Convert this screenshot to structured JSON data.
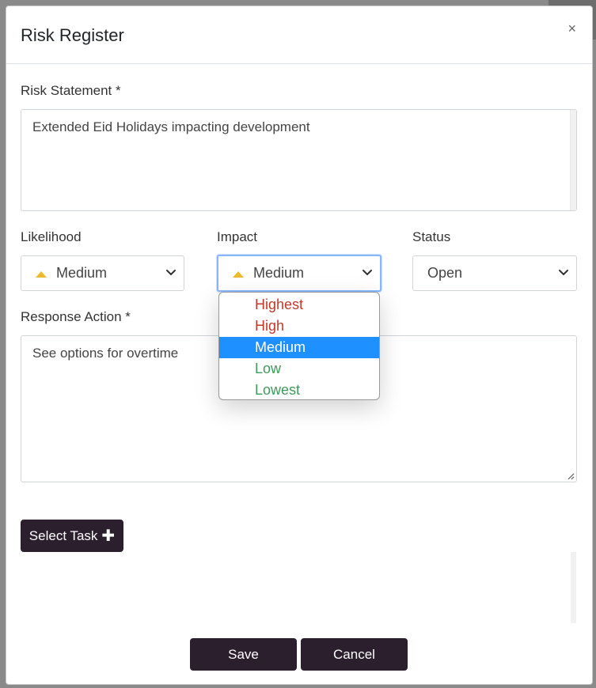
{
  "modal": {
    "title": "Risk Register",
    "close_glyph": "×"
  },
  "risk_statement": {
    "label": "Risk Statement *",
    "value": "Extended Eid Holidays impacting development"
  },
  "likelihood": {
    "label": "Likelihood",
    "value": "Medium",
    "icon": "triangle-up-icon"
  },
  "impact": {
    "label": "Impact",
    "value": "Medium",
    "icon": "triangle-up-icon",
    "options": [
      {
        "label": "Highest",
        "color": "#c0392b"
      },
      {
        "label": "High",
        "color": "#c0392b"
      },
      {
        "label": "Medium",
        "color": "#ffffff",
        "selected": true
      },
      {
        "label": "Low",
        "color": "#3d9a5a"
      },
      {
        "label": "Lowest",
        "color": "#3d9a5a"
      }
    ]
  },
  "status": {
    "label": "Status",
    "value": "Open"
  },
  "response_action": {
    "label": "Response Action *",
    "value": "See options for overtime"
  },
  "buttons": {
    "select_task": "Select Task",
    "save": "Save",
    "cancel": "Cancel"
  },
  "colors": {
    "primary_dark": "#2b1f2d",
    "medium_indicator": "#f0b92a",
    "selected_option": "#1e90ff"
  }
}
